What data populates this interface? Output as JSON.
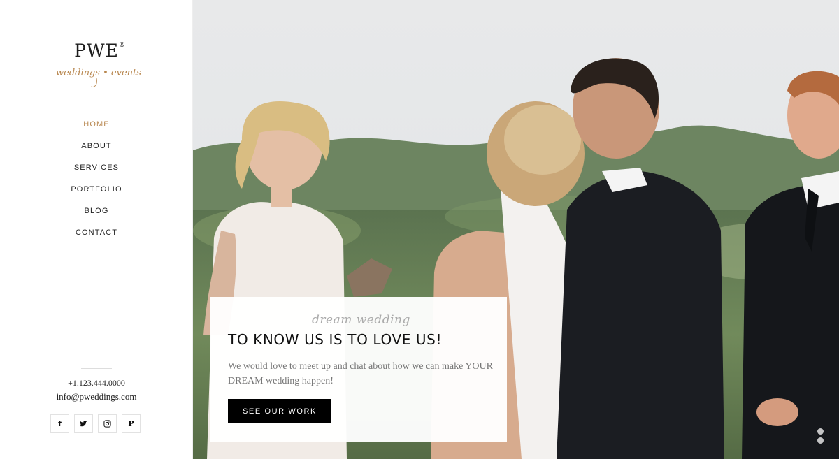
{
  "brand": {
    "name": "PWE",
    "registered_mark": "®",
    "tagline": "weddings • events"
  },
  "nav": {
    "items": [
      {
        "label": "HOME",
        "active": true
      },
      {
        "label": "ABOUT",
        "active": false
      },
      {
        "label": "SERVICES",
        "active": false
      },
      {
        "label": "PORTFOLIO",
        "active": false
      },
      {
        "label": "BLOG",
        "active": false
      },
      {
        "label": "CONTACT",
        "active": false
      }
    ]
  },
  "contact": {
    "phone": "+1.123.444.0000",
    "email": "info@pweddings.com"
  },
  "social": [
    {
      "icon": "facebook-icon",
      "glyph": "f"
    },
    {
      "icon": "twitter-icon",
      "glyph": ""
    },
    {
      "icon": "instagram-icon",
      "glyph": ""
    },
    {
      "icon": "pinterest-icon",
      "glyph": "P"
    }
  ],
  "hero_card": {
    "script_heading": "dream wedding",
    "title": "TO KNOW US IS TO LOVE US!",
    "text": "We would love to meet up and chat about how we can make YOUR DREAM wedding happen!",
    "button_label": "SEE OUR WORK"
  },
  "colors": {
    "accent": "#b8874f",
    "button_bg": "#000000",
    "text": "#222222"
  }
}
